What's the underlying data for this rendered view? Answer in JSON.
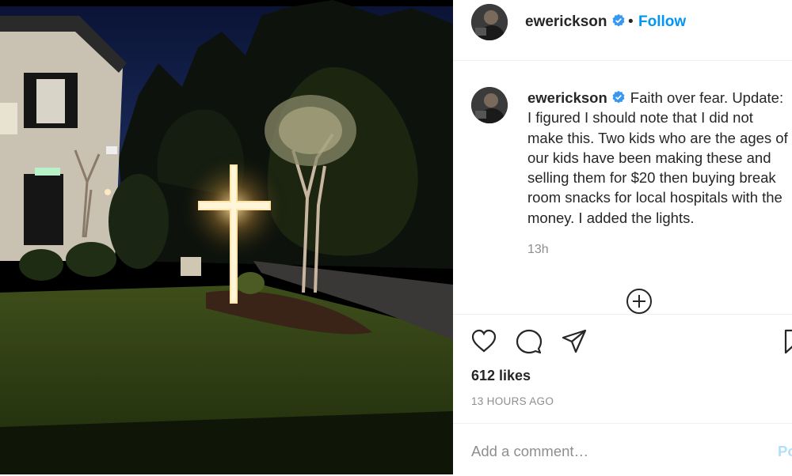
{
  "photo": {
    "description_icon": "photo"
  },
  "header": {
    "username": "ewerickson",
    "separator": "•",
    "follow_label": "Follow",
    "options_icon": "more-options-icon"
  },
  "caption": {
    "username": "ewerickson",
    "text": "Faith over fear. Update: I figured I should note that I did not make this. Two kids who are the ages of our kids have been making these and selling them for $20 then buying break room snacks for local hospitals with the money. I added the lights.",
    "time": "13h"
  },
  "actions": {
    "like_icon": "heart-icon",
    "comment_icon": "comment-icon",
    "share_icon": "paper-plane-icon",
    "save_icon": "bookmark-icon"
  },
  "likes": "612 likes",
  "timestamp": "13 HOURS AGO",
  "comment": {
    "placeholder": "Add a comment…",
    "post_label": "Post"
  },
  "colors": {
    "accent": "#0095f6",
    "post_disabled": "#b2dffc",
    "muted": "#8e8e8e"
  }
}
